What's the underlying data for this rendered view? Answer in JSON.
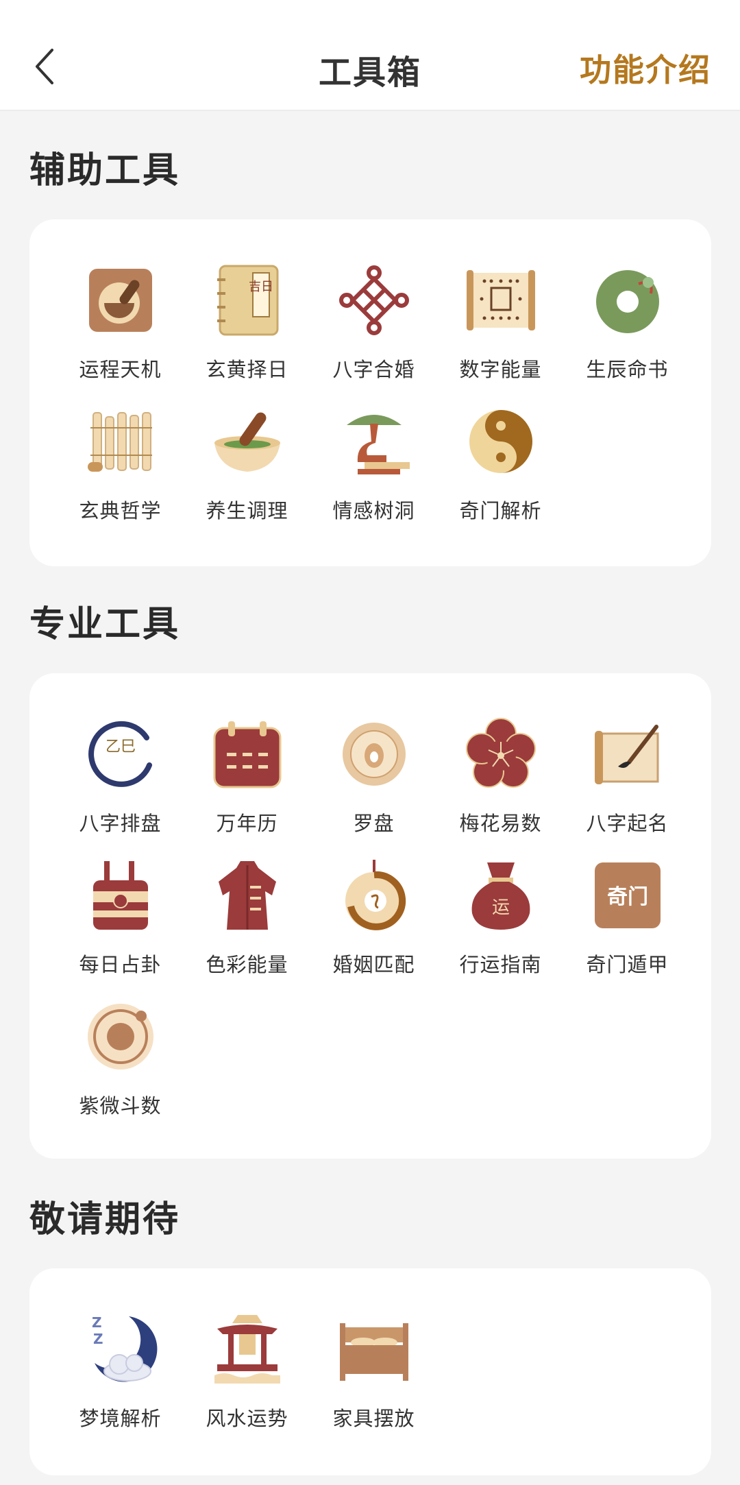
{
  "header": {
    "title": "工具箱",
    "intro_label": "功能介绍"
  },
  "sections": [
    {
      "title": "辅助工具",
      "items": [
        {
          "label": "运程天机",
          "icon": "pestle-bowl-icon"
        },
        {
          "label": "玄黄择日",
          "icon": "almanac-book-icon"
        },
        {
          "label": "八字合婚",
          "icon": "chinese-knot-icon"
        },
        {
          "label": "数字能量",
          "icon": "number-scroll-icon"
        },
        {
          "label": "生辰命书",
          "icon": "jade-disc-icon"
        },
        {
          "label": "玄典哲学",
          "icon": "bamboo-slips-icon"
        },
        {
          "label": "养生调理",
          "icon": "mortar-pestle-icon"
        },
        {
          "label": "情感树洞",
          "icon": "bonsai-tree-icon"
        },
        {
          "label": "奇门解析",
          "icon": "yin-yang-icon"
        }
      ]
    },
    {
      "title": "专业工具",
      "items": [
        {
          "label": "八字排盘",
          "icon": "ink-circle-icon"
        },
        {
          "label": "万年历",
          "icon": "calendar-icon"
        },
        {
          "label": "罗盘",
          "icon": "compass-icon"
        },
        {
          "label": "梅花易数",
          "icon": "plum-blossom-icon"
        },
        {
          "label": "八字起名",
          "icon": "brush-scroll-icon"
        },
        {
          "label": "每日占卦",
          "icon": "divination-tube-icon"
        },
        {
          "label": "色彩能量",
          "icon": "qipao-dress-icon"
        },
        {
          "label": "婚姻匹配",
          "icon": "jade-pendant-icon"
        },
        {
          "label": "行运指南",
          "icon": "lucky-bag-icon"
        },
        {
          "label": "奇门遁甲",
          "icon": "qimen-seal-icon"
        },
        {
          "label": "紫微斗数",
          "icon": "orbit-star-icon"
        }
      ]
    },
    {
      "title": "敬请期待",
      "items": [
        {
          "label": "梦境解析",
          "icon": "moon-sleep-icon"
        },
        {
          "label": "风水运势",
          "icon": "pavilion-icon"
        },
        {
          "label": "家具摆放",
          "icon": "bed-icon"
        }
      ]
    }
  ],
  "icon_text": {
    "almanac": "吉日",
    "lucky_bag": "运",
    "qimen": "奇门",
    "ink": "乙巳",
    "sleep": "Z"
  },
  "colors": {
    "accent": "#b5781e",
    "brown": "#b8805a",
    "maroon": "#9b3b3b",
    "cream": "#f2d9b0",
    "green": "#7a9a5c"
  }
}
